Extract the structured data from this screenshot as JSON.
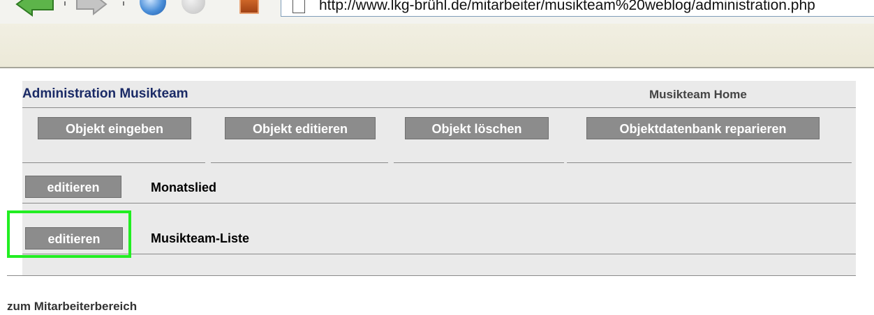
{
  "browser": {
    "address_url": "http://www.lkg-brühl.de/mitarbeiter/musikteam%20weblog/administration.php"
  },
  "page": {
    "title": "Administration Musikteam",
    "home_link": "Musikteam Home",
    "actions": [
      {
        "label": "Objekt eingeben"
      },
      {
        "label": "Objekt editieren"
      },
      {
        "label": "Objekt löschen"
      },
      {
        "label": "Objektdatenbank reparieren"
      }
    ],
    "objects": [
      {
        "button": "editieren",
        "label": "Monatslied"
      },
      {
        "button": "editieren",
        "label": "Musikteam-Liste"
      }
    ],
    "footer_link": "zum Mitarbeiterbereich"
  },
  "colors": {
    "highlight": "#22ee22",
    "title": "#1a2a66",
    "button_bg": "#8c8c8c"
  }
}
